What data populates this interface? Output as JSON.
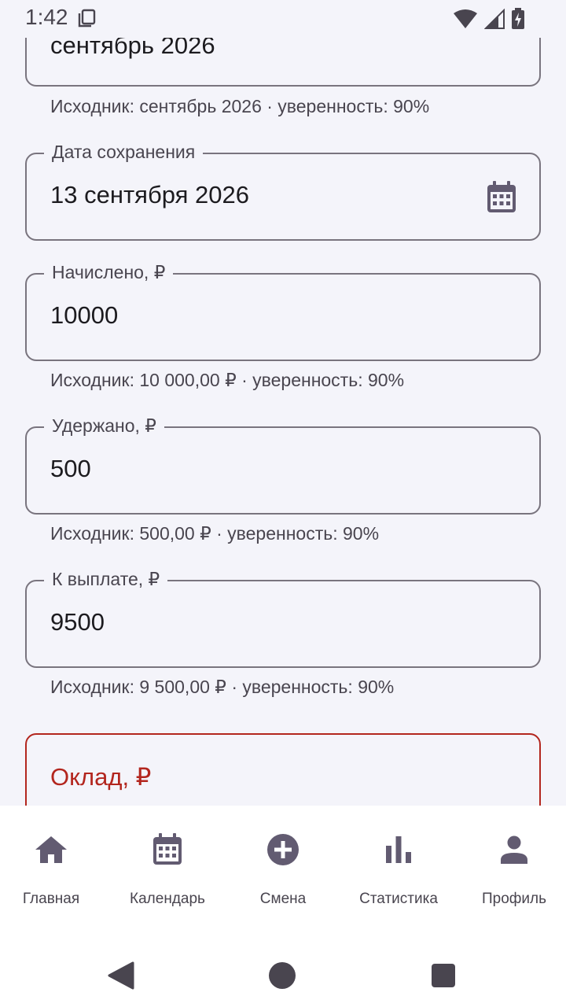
{
  "status_bar": {
    "time": "1:42"
  },
  "form": {
    "period": {
      "value": "сентябрь 2026",
      "helper": "Исходник: сентябрь 2026 · уверенность: 90%"
    },
    "save_date": {
      "label": "Дата сохранения",
      "value": "13 сентября 2026",
      "trailing_icon": "calendar-icon"
    },
    "accrued": {
      "label": "Начислено, ₽",
      "value": "10000",
      "helper": "Исходник: 10 000,00 ₽ · уверенность: 90%"
    },
    "withheld": {
      "label": "Удержано, ₽",
      "value": "500",
      "helper": "Исходник: 500,00 ₽ · уверенность: 90%"
    },
    "payout": {
      "label": "К выплате, ₽",
      "value": "9500",
      "helper": "Исходник: 9 500,00 ₽ · уверенность: 90%"
    },
    "salary": {
      "placeholder": "Оклад, ₽"
    }
  },
  "bottom_nav": {
    "items": [
      {
        "label": "Главная",
        "icon": "home-icon"
      },
      {
        "label": "Календарь",
        "icon": "calendar-icon"
      },
      {
        "label": "Смена",
        "icon": "add-circle-icon"
      },
      {
        "label": "Статистика",
        "icon": "bar-chart-icon"
      },
      {
        "label": "Профиль",
        "icon": "person-icon"
      }
    ]
  },
  "colors": {
    "background": "#f4f4fa",
    "outline": "#79747e",
    "error": "#b3261e",
    "icon": "#625b71"
  }
}
